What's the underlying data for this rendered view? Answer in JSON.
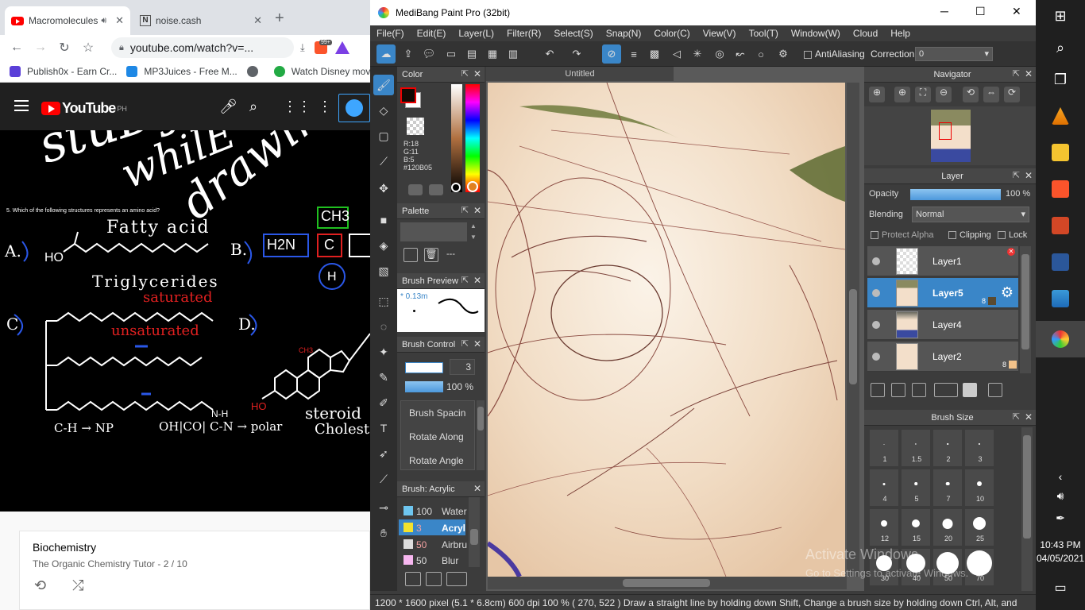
{
  "chrome": {
    "tabs": [
      {
        "title": "Macromolecules",
        "active": true,
        "audio_icon": "speaker-icon"
      },
      {
        "title": "noise.cash",
        "active": false
      }
    ],
    "url": "youtube.com/watch?v=...",
    "bookmarks": [
      "Publish0x - Earn Cr...",
      "MP3Juices - Free M...",
      "Watch Disney mov"
    ],
    "extension_badge": "99+",
    "youtube": {
      "logo": "YouTube",
      "region": "PH",
      "playlist_title": "Biochemistry",
      "playlist_sub": "The Organic Chemistry Tutor - 2 / 10"
    },
    "video": {
      "overlay_text": [
        "stuDying",
        "whilE",
        "drawing"
      ],
      "question": "5. Which of the following structures represents an amino acid?",
      "labels": {
        "a": "A.",
        "b": "B.",
        "c": "C",
        "d": "D.",
        "fatty_acid": "Fatty acid",
        "triglycerides": "Triglycerides",
        "saturated": "saturated",
        "unsaturated": "unsaturated",
        "ch3": "CH3",
        "h2n": "H2N",
        "h": "H",
        "ho": "HO",
        "ch_np": "C-H → NP",
        "oh_co_cn": "OH|CO| C-N → polar",
        "steroid": "steroid",
        "cholest": "Cholest",
        "nh": "N-H",
        "ho_red": "HO",
        "ch3_red": "CH3"
      }
    }
  },
  "medibang": {
    "title": "MediBang Paint Pro (32bit)",
    "menu": [
      "File(F)",
      "Edit(E)",
      "Layer(L)",
      "Filter(R)",
      "Select(S)",
      "Snap(N)",
      "Color(C)",
      "View(V)",
      "Tool(T)",
      "Window(W)",
      "Cloud",
      "Help"
    ],
    "antialiasing_label": "AntiAliasing",
    "correction_label": "Correction",
    "correction_value": "0",
    "canvas_tab": "Untitled",
    "color_panel": {
      "title": "Color",
      "rgb": [
        "R:18",
        "G:11",
        "B:5"
      ],
      "hex": "#120B05",
      "primary": "#120B05"
    },
    "palette_panel": {
      "title": "Palette",
      "dash": "---"
    },
    "brush_preview": {
      "title": "Brush Preview",
      "size": "* 0.13m"
    },
    "brush_control": {
      "title": "Brush Control",
      "size": "3",
      "opacity": "100 %",
      "options": [
        "Brush Spacin",
        "Rotate Along",
        "Rotate Angle"
      ]
    },
    "brush_list": {
      "title": "Brush: Acrylic",
      "items": [
        {
          "size": "100",
          "name": "Water",
          "color": "#6ec6f0",
          "selected": false
        },
        {
          "size": "3",
          "name": "Acryl",
          "color": "#f2e22e",
          "selected": true
        },
        {
          "size": "50",
          "name": "Airbru",
          "color": "#dddddd",
          "selected": false
        },
        {
          "size": "50",
          "name": "Blur",
          "color": "#f7b7f0",
          "selected": false
        }
      ]
    },
    "navigator": {
      "title": "Navigator"
    },
    "layer_panel": {
      "title": "Layer",
      "opacity_label": "Opacity",
      "opacity_value": "100 %",
      "blending_label": "Blending",
      "blending_value": "Normal",
      "protect_alpha": "Protect Alpha",
      "clipping": "Clipping",
      "lock": "Lock",
      "layers": [
        {
          "name": "Layer1",
          "selected": false
        },
        {
          "name": "Layer5",
          "selected": true,
          "badge": "8"
        },
        {
          "name": "Layer4",
          "selected": false
        },
        {
          "name": "Layer2",
          "selected": false,
          "badge": "8"
        }
      ]
    },
    "brush_size": {
      "title": "Brush Size",
      "sizes": [
        "1",
        "1.5",
        "2",
        "3",
        "4",
        "5",
        "7",
        "10",
        "12",
        "15",
        "20",
        "25",
        "30",
        "40",
        "50",
        "70"
      ]
    },
    "status": "1200 * 1600 pixel   (5.1 * 6.8cm)   600 dpi   100 %   ( 270, 522 )   Draw a straight line by holding down Shift, Change a brush size by holding down Ctrl, Alt, and",
    "watermark_title": "Activate Windows",
    "watermark_sub": "Go to Settings to activate Windows."
  },
  "taskbar": {
    "time": "10:43 PM",
    "date": "04/05/2021"
  }
}
